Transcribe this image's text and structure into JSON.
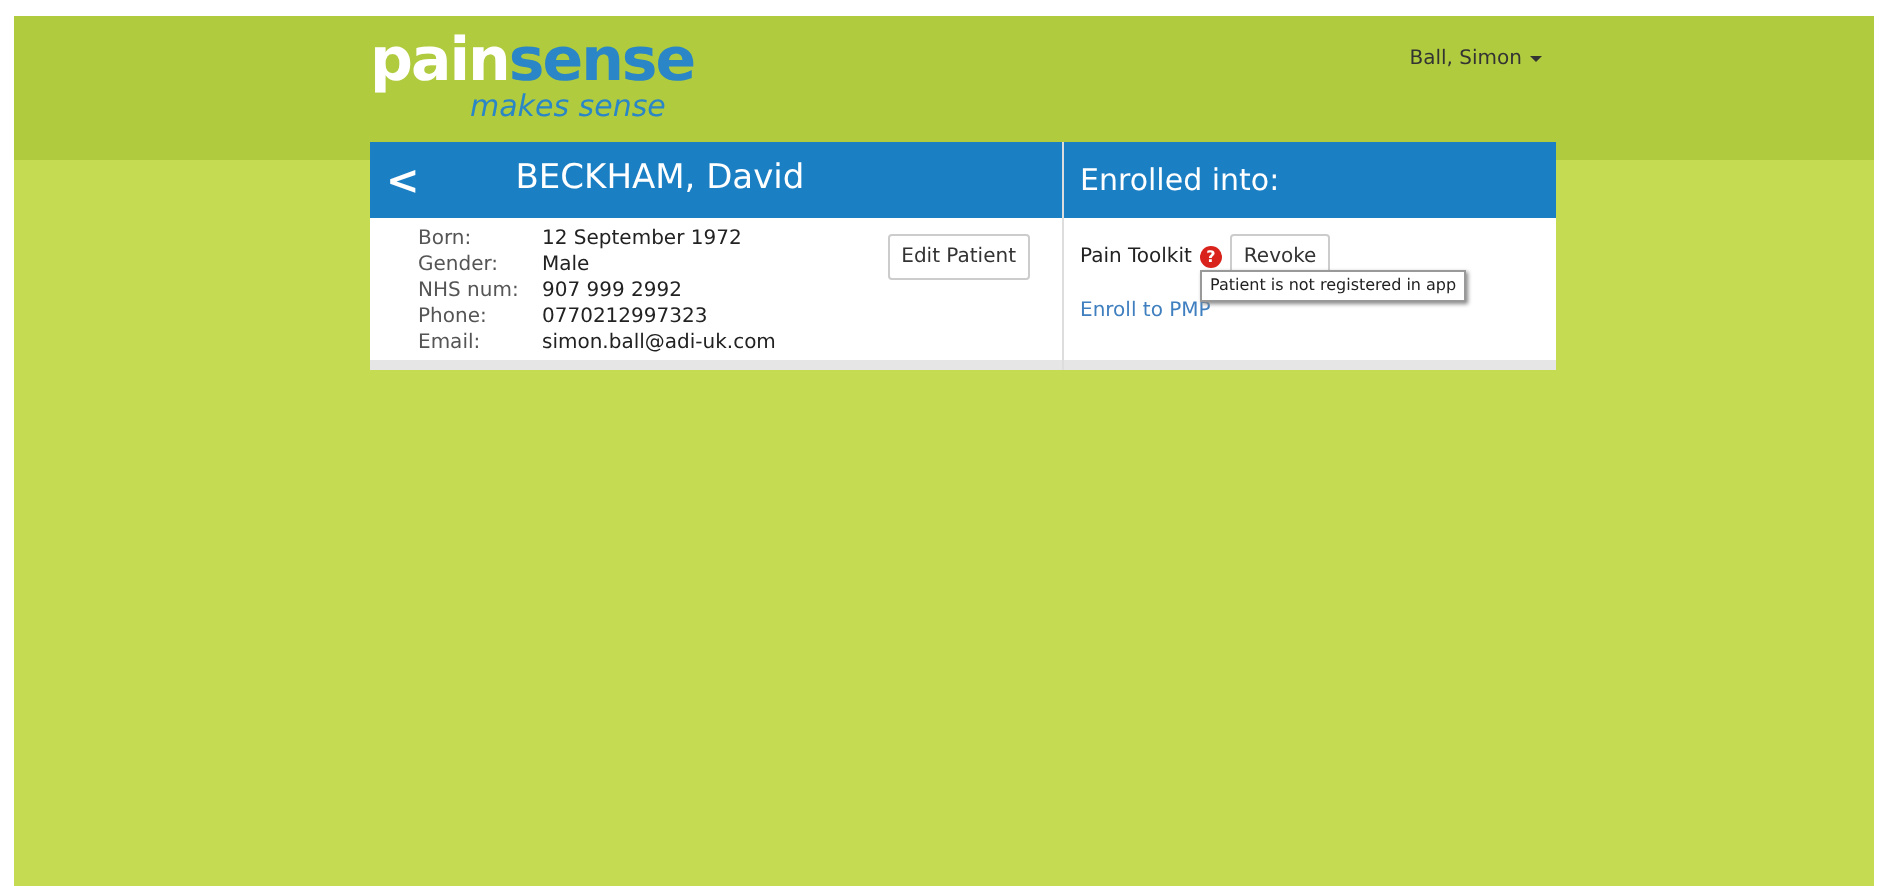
{
  "logo": {
    "word_1": "pain",
    "word_2": "sense",
    "tagline": "makes sense"
  },
  "user_menu": {
    "label": "Ball, Simon"
  },
  "patient": {
    "name": "BECKHAM, David",
    "back": "<",
    "fields": [
      {
        "label": "Born:",
        "value": "12 September 1972"
      },
      {
        "label": "Gender:",
        "value": "Male"
      },
      {
        "label": "NHS num:",
        "value": "907 999 2992"
      },
      {
        "label": "Phone:",
        "value": "0770212997323"
      },
      {
        "label": "Email:",
        "value": "simon.ball@adi-uk.com"
      }
    ],
    "edit_button": "Edit Patient"
  },
  "enrolled": {
    "title": "Enrolled into:",
    "programs": [
      {
        "name": "Pain Toolkit",
        "warning": "?",
        "button": "Revoke"
      }
    ],
    "enroll_link": "Enroll to PMP",
    "tooltip": "Patient is not registered in app"
  }
}
